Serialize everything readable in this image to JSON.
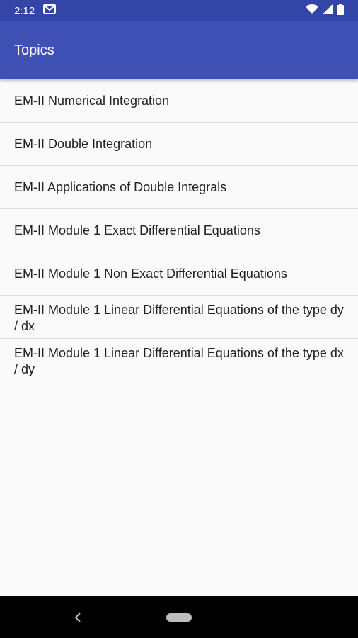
{
  "status": {
    "time": "2:12"
  },
  "appbar": {
    "title": "Topics"
  },
  "topics": [
    "EM-II Numerical Integration",
    "EM-II Double Integration",
    "EM-II Applications of Double Integrals",
    "EM-II Module 1 Exact Differential Equations",
    "EM-II Module 1 Non Exact Differential Equations",
    "EM-II Module 1 Linear Differential Equations of the type dy / dx",
    "EM-II Module 1 Linear Differential Equations of the type dx / dy"
  ],
  "colors": {
    "primary": "#3f51b5",
    "primary_dark": "#3346a8",
    "background": "#fafafa",
    "text": "#212121",
    "divider": "#dedede"
  },
  "icons": [
    "mail-icon",
    "wifi-icon",
    "signal-icon",
    "battery-icon",
    "back-icon",
    "home-icon"
  ]
}
